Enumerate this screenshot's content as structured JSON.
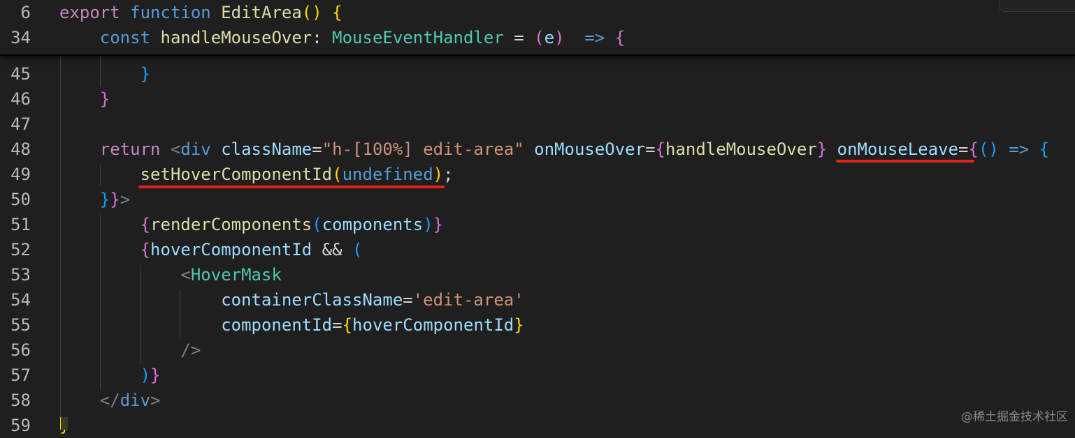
{
  "editor": {
    "sticky": [
      {
        "num": "6",
        "tokens": [
          {
            "t": "export ",
            "c": "kw"
          },
          {
            "t": "function ",
            "c": "kb"
          },
          {
            "t": "EditArea",
            "c": "fn"
          },
          {
            "t": "() ",
            "c": "b1"
          },
          {
            "t": "{",
            "c": "b1"
          }
        ]
      },
      {
        "num": "34",
        "tokens": [
          {
            "t": "    ",
            "c": "pl"
          },
          {
            "t": "const ",
            "c": "kb"
          },
          {
            "t": "handleMouseOver",
            "c": "fn"
          },
          {
            "t": ": ",
            "c": "pl"
          },
          {
            "t": "MouseEventHandler",
            "c": "ty"
          },
          {
            "t": " = ",
            "c": "pl"
          },
          {
            "t": "(",
            "c": "b2"
          },
          {
            "t": "e",
            "c": "id"
          },
          {
            "t": ")",
            "c": "b2"
          },
          {
            "t": "  => ",
            "c": "kb"
          },
          {
            "t": "{",
            "c": "b2"
          }
        ]
      }
    ],
    "lines": [
      {
        "num": "45",
        "tokens": [
          {
            "t": "        ",
            "c": "pl"
          },
          {
            "t": "}",
            "c": "b3"
          }
        ]
      },
      {
        "num": "46",
        "tokens": [
          {
            "t": "    ",
            "c": "pl"
          },
          {
            "t": "}",
            "c": "b2"
          }
        ]
      },
      {
        "num": "47",
        "tokens": []
      },
      {
        "num": "48",
        "tokens": [
          {
            "t": "    ",
            "c": "pl"
          },
          {
            "t": "return ",
            "c": "kw"
          },
          {
            "t": "<",
            "c": "tg"
          },
          {
            "t": "div ",
            "c": "kb"
          },
          {
            "t": "className",
            "c": "id"
          },
          {
            "t": "=",
            "c": "pl"
          },
          {
            "t": "\"h-[100%] edit-area\" ",
            "c": "st"
          },
          {
            "t": "onMouseOver",
            "c": "id"
          },
          {
            "t": "=",
            "c": "pl"
          },
          {
            "t": "{",
            "c": "b2"
          },
          {
            "t": "handleMouseOver",
            "c": "fn"
          },
          {
            "t": "} ",
            "c": "b2"
          },
          {
            "t": "onMouseLeave",
            "c": "id"
          },
          {
            "t": "=",
            "c": "pl"
          },
          {
            "t": "{",
            "c": "b2"
          },
          {
            "t": "() ",
            "c": "b3"
          },
          {
            "t": "=> ",
            "c": "kb"
          },
          {
            "t": "{",
            "c": "b3"
          }
        ]
      },
      {
        "num": "49",
        "tokens": [
          {
            "t": "        ",
            "c": "pl"
          },
          {
            "t": "setHoverComponentId",
            "c": "fn"
          },
          {
            "t": "(",
            "c": "b1"
          },
          {
            "t": "undefined",
            "c": "kb"
          },
          {
            "t": ")",
            "c": "b1"
          },
          {
            "t": ";",
            "c": "pl"
          }
        ]
      },
      {
        "num": "50",
        "tokens": [
          {
            "t": "    ",
            "c": "pl"
          },
          {
            "t": "}",
            "c": "b3"
          },
          {
            "t": "}",
            "c": "b2"
          },
          {
            "t": ">",
            "c": "tg"
          }
        ]
      },
      {
        "num": "51",
        "tokens": [
          {
            "t": "        ",
            "c": "pl"
          },
          {
            "t": "{",
            "c": "b2"
          },
          {
            "t": "renderComponents",
            "c": "fn"
          },
          {
            "t": "(",
            "c": "b3"
          },
          {
            "t": "components",
            "c": "id"
          },
          {
            "t": ")",
            "c": "b3"
          },
          {
            "t": "}",
            "c": "b2"
          }
        ]
      },
      {
        "num": "52",
        "tokens": [
          {
            "t": "        ",
            "c": "pl"
          },
          {
            "t": "{",
            "c": "b2"
          },
          {
            "t": "hoverComponentId",
            "c": "id"
          },
          {
            "t": " && ",
            "c": "pl"
          },
          {
            "t": "(",
            "c": "b3"
          }
        ]
      },
      {
        "num": "53",
        "tokens": [
          {
            "t": "            ",
            "c": "pl"
          },
          {
            "t": "<",
            "c": "tg"
          },
          {
            "t": "HoverMask",
            "c": "ty"
          }
        ]
      },
      {
        "num": "54",
        "tokens": [
          {
            "t": "                ",
            "c": "pl"
          },
          {
            "t": "containerClassName",
            "c": "id"
          },
          {
            "t": "=",
            "c": "pl"
          },
          {
            "t": "'edit-area'",
            "c": "st"
          }
        ]
      },
      {
        "num": "55",
        "tokens": [
          {
            "t": "                ",
            "c": "pl"
          },
          {
            "t": "componentId",
            "c": "id"
          },
          {
            "t": "=",
            "c": "pl"
          },
          {
            "t": "{",
            "c": "b1"
          },
          {
            "t": "hoverComponentId",
            "c": "id"
          },
          {
            "t": "}",
            "c": "b1"
          }
        ]
      },
      {
        "num": "56",
        "tokens": [
          {
            "t": "            ",
            "c": "pl"
          },
          {
            "t": "/>",
            "c": "tg"
          }
        ]
      },
      {
        "num": "57",
        "tokens": [
          {
            "t": "        ",
            "c": "pl"
          },
          {
            "t": ")",
            "c": "b3"
          },
          {
            "t": "}",
            "c": "b2"
          }
        ]
      },
      {
        "num": "58",
        "tokens": [
          {
            "t": "    ",
            "c": "pl"
          },
          {
            "t": "</",
            "c": "tg"
          },
          {
            "t": "div",
            "c": "kb"
          },
          {
            "t": ">",
            "c": "tg"
          }
        ]
      },
      {
        "num": "59",
        "tokens": [
          {
            "t": "}",
            "c": "b1"
          }
        ]
      }
    ]
  },
  "watermark": "@稀土掘金技术社区",
  "colors": {
    "background": "#1f1f1f",
    "underline": "#e62117",
    "line_number": "#b9b9b9"
  }
}
